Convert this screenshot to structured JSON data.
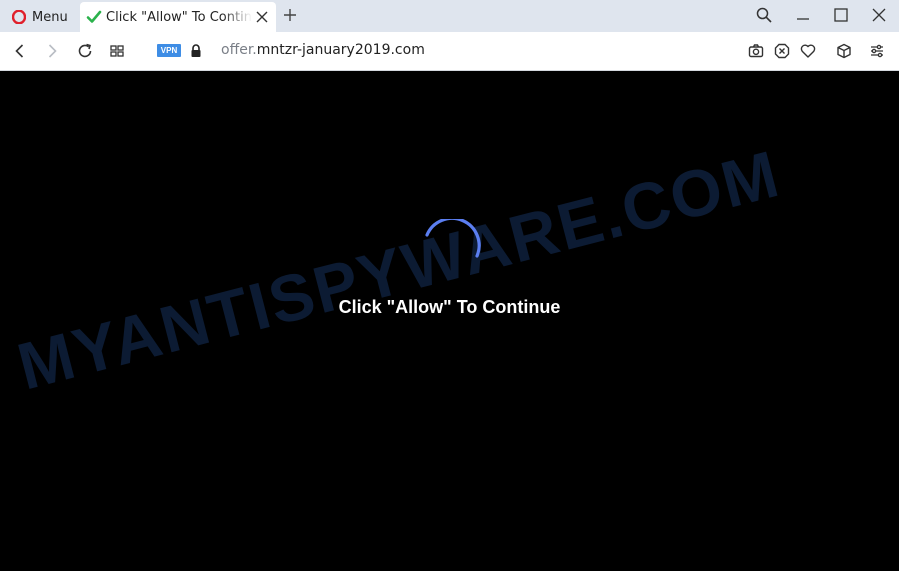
{
  "browser": {
    "menu_label": "Menu",
    "tab_title": "Click \"Allow\" To Continue",
    "vpn_label": "VPN",
    "url_prefix": "offer.",
    "url_domain": "mntzr-january2019.com"
  },
  "page": {
    "message": "Click \"Allow\" To Continue",
    "watermark": "MYANTISPYWARE.COM"
  },
  "colors": {
    "tabstrip": "#dfe5ee",
    "page_background": "#000000",
    "spinner": "#5b7ef0",
    "opera_red": "#e0202b",
    "tab_check": "#2bb24c",
    "vpn": "#3e8de5"
  },
  "icons": {
    "menu": "opera-logo-icon",
    "tab_status": "check-icon",
    "tab_close": "close-icon",
    "new_tab": "plus-icon",
    "search": "search-icon",
    "minimize": "minimize-icon",
    "maximize": "maximize-icon",
    "close": "close-icon",
    "back": "back-arrow-icon",
    "forward": "forward-arrow-icon",
    "reload": "reload-icon",
    "tabs_grid": "grid-icon",
    "lock": "lock-icon",
    "snapshot": "camera-icon",
    "adblock": "adblock-icon",
    "bookmark": "heart-icon",
    "extensions": "cube-icon",
    "easy_setup": "sliders-icon"
  }
}
